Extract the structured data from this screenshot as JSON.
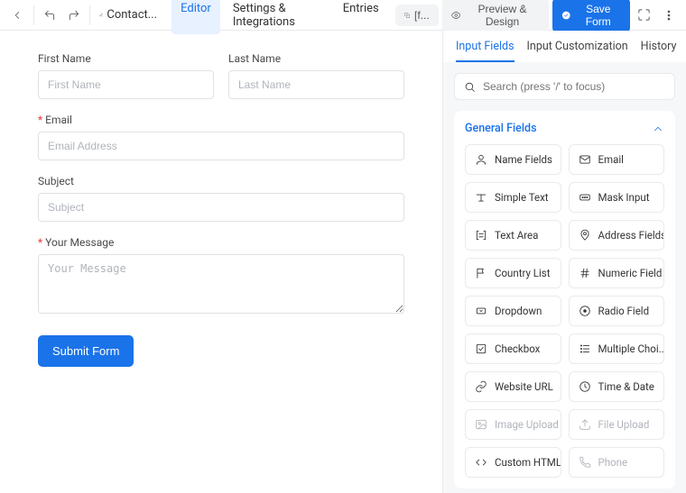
{
  "header": {
    "form_name": "Contact...",
    "tabs": [
      "Editor",
      "Settings & Integrations",
      "Entries"
    ],
    "shortcode_btn": "[f...",
    "preview_btn": "Preview & Design",
    "save_btn": "Save Form"
  },
  "form": {
    "fields": {
      "first_name": {
        "label": "First Name",
        "placeholder": "First Name"
      },
      "last_name": {
        "label": "Last Name",
        "placeholder": "Last Name"
      },
      "email": {
        "label": "Email",
        "placeholder": "Email Address"
      },
      "subject": {
        "label": "Subject",
        "placeholder": "Subject"
      },
      "message": {
        "label": "Your Message",
        "placeholder": "Your Message"
      }
    },
    "submit_label": "Submit Form"
  },
  "sidebar": {
    "tabs": [
      "Input Fields",
      "Input Customization",
      "History"
    ],
    "search_placeholder": "Search (press '/' to focus)",
    "section_title": "General Fields",
    "fields": [
      {
        "label": "Name Fields",
        "icon": "user"
      },
      {
        "label": "Email",
        "icon": "mail"
      },
      {
        "label": "Simple Text",
        "icon": "text"
      },
      {
        "label": "Mask Input",
        "icon": "mask"
      },
      {
        "label": "Text Area",
        "icon": "area"
      },
      {
        "label": "Address Fields",
        "icon": "pin"
      },
      {
        "label": "Country List",
        "icon": "flag"
      },
      {
        "label": "Numeric Field",
        "icon": "hash"
      },
      {
        "label": "Dropdown",
        "icon": "drop"
      },
      {
        "label": "Radio Field",
        "icon": "radio"
      },
      {
        "label": "Checkbox",
        "icon": "check"
      },
      {
        "label": "Multiple Choi...",
        "icon": "list"
      },
      {
        "label": "Website URL",
        "icon": "link"
      },
      {
        "label": "Time & Date",
        "icon": "clock"
      },
      {
        "label": "Image Upload",
        "icon": "image",
        "disabled": true
      },
      {
        "label": "File Upload",
        "icon": "upload",
        "disabled": true
      },
      {
        "label": "Custom HTML",
        "icon": "code"
      },
      {
        "label": "Phone",
        "icon": "phone",
        "disabled": true
      }
    ]
  }
}
